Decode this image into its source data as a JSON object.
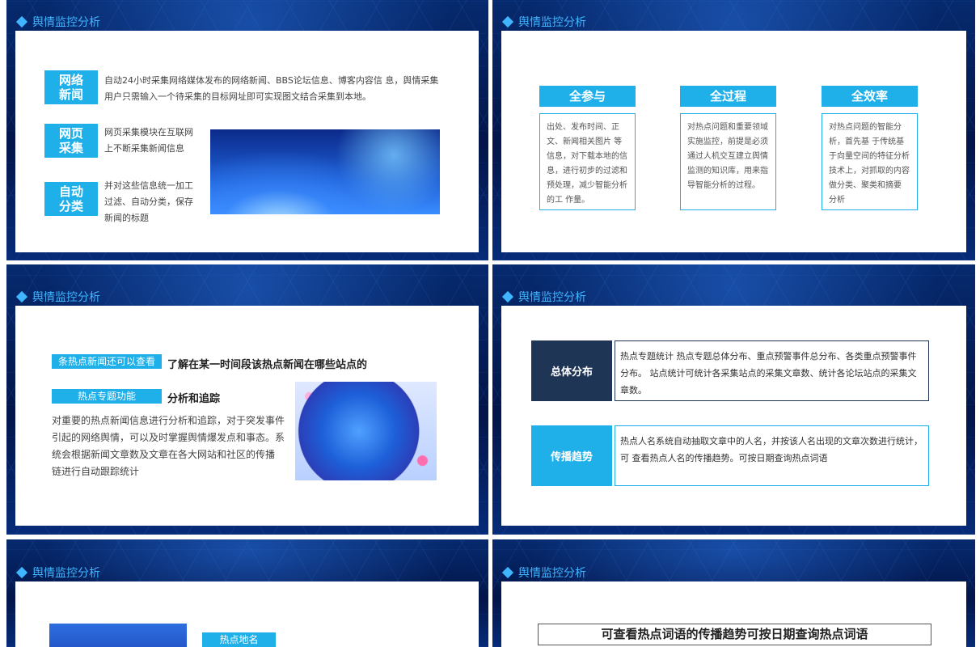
{
  "slide_title": "舆情监控分析",
  "slide1": {
    "tags": [
      "网络\n新闻",
      "网页\n采集",
      "自动\n分类"
    ],
    "text1": "自动24小时采集网络媒体发布的网络新闻、BBS论坛信息、博客内容信 息，舆情采集用户只需输入一个待采集的目标网址即可实现图文结合采集到本地。",
    "text2": "网页采集模块在互联网上不断采集新闻信息",
    "text3": "并对这些信息统一加工过滤、自动分类，保存新闻的标题"
  },
  "slide2": {
    "cards": [
      {
        "head": "全参与",
        "body": "出处、发布时间、正文、新闻相关图片 等信息，对下载本地的信息，进行初步的过滤和预处理，减少智能分析的工 作量。"
      },
      {
        "head": "全过程",
        "body": "对热点问题和重要领域实施监控，前提是必须通过人机交互建立舆情 监测的知识库，用来指导智能分析的过程。"
      },
      {
        "head": "全效率",
        "body": "对热点问题的智能分析，首先基 于传统基于向量空间的特征分析技术上，对抓取的内容做分类、聚类和摘要 分析"
      }
    ]
  },
  "slide3": {
    "label1": "条热点新闻还可以查看",
    "bold1": "了解在某一时间段该热点新闻在哪些站点的",
    "label2": "热点专题功能",
    "bold2": "分析和追踪",
    "para": "对重要的热点新闻信息进行分析和追踪，对于突发事件引起的网络舆情，可以及时掌握舆情爆发点和事态。系统会根据新闻文章数及文章在各大网站和社区的传播 链进行自动跟踪统计"
  },
  "slide4": {
    "rows": [
      {
        "label": "总体分布",
        "color": "#1f3556",
        "text": "热点专题统计 热点专题总体分布、重点预警事件总分布、各类重点预警事件分布。 站点统计可统计各采集站点的采集文章数、统计各论坛站点的采集文章数。"
      },
      {
        "label": "传播趋势",
        "color": "#1fb0ea",
        "text": "热点人名系统自动抽取文章中的人名，并按该人名出现的文章次数进行统计，可 查看热点人名的传播趋势。可按日期查询热点词语"
      }
    ]
  },
  "slide5": {
    "label": "热点地名"
  },
  "slide6": {
    "heading": "可查看热点词语的传播趋势可按日期查询热点词语"
  }
}
